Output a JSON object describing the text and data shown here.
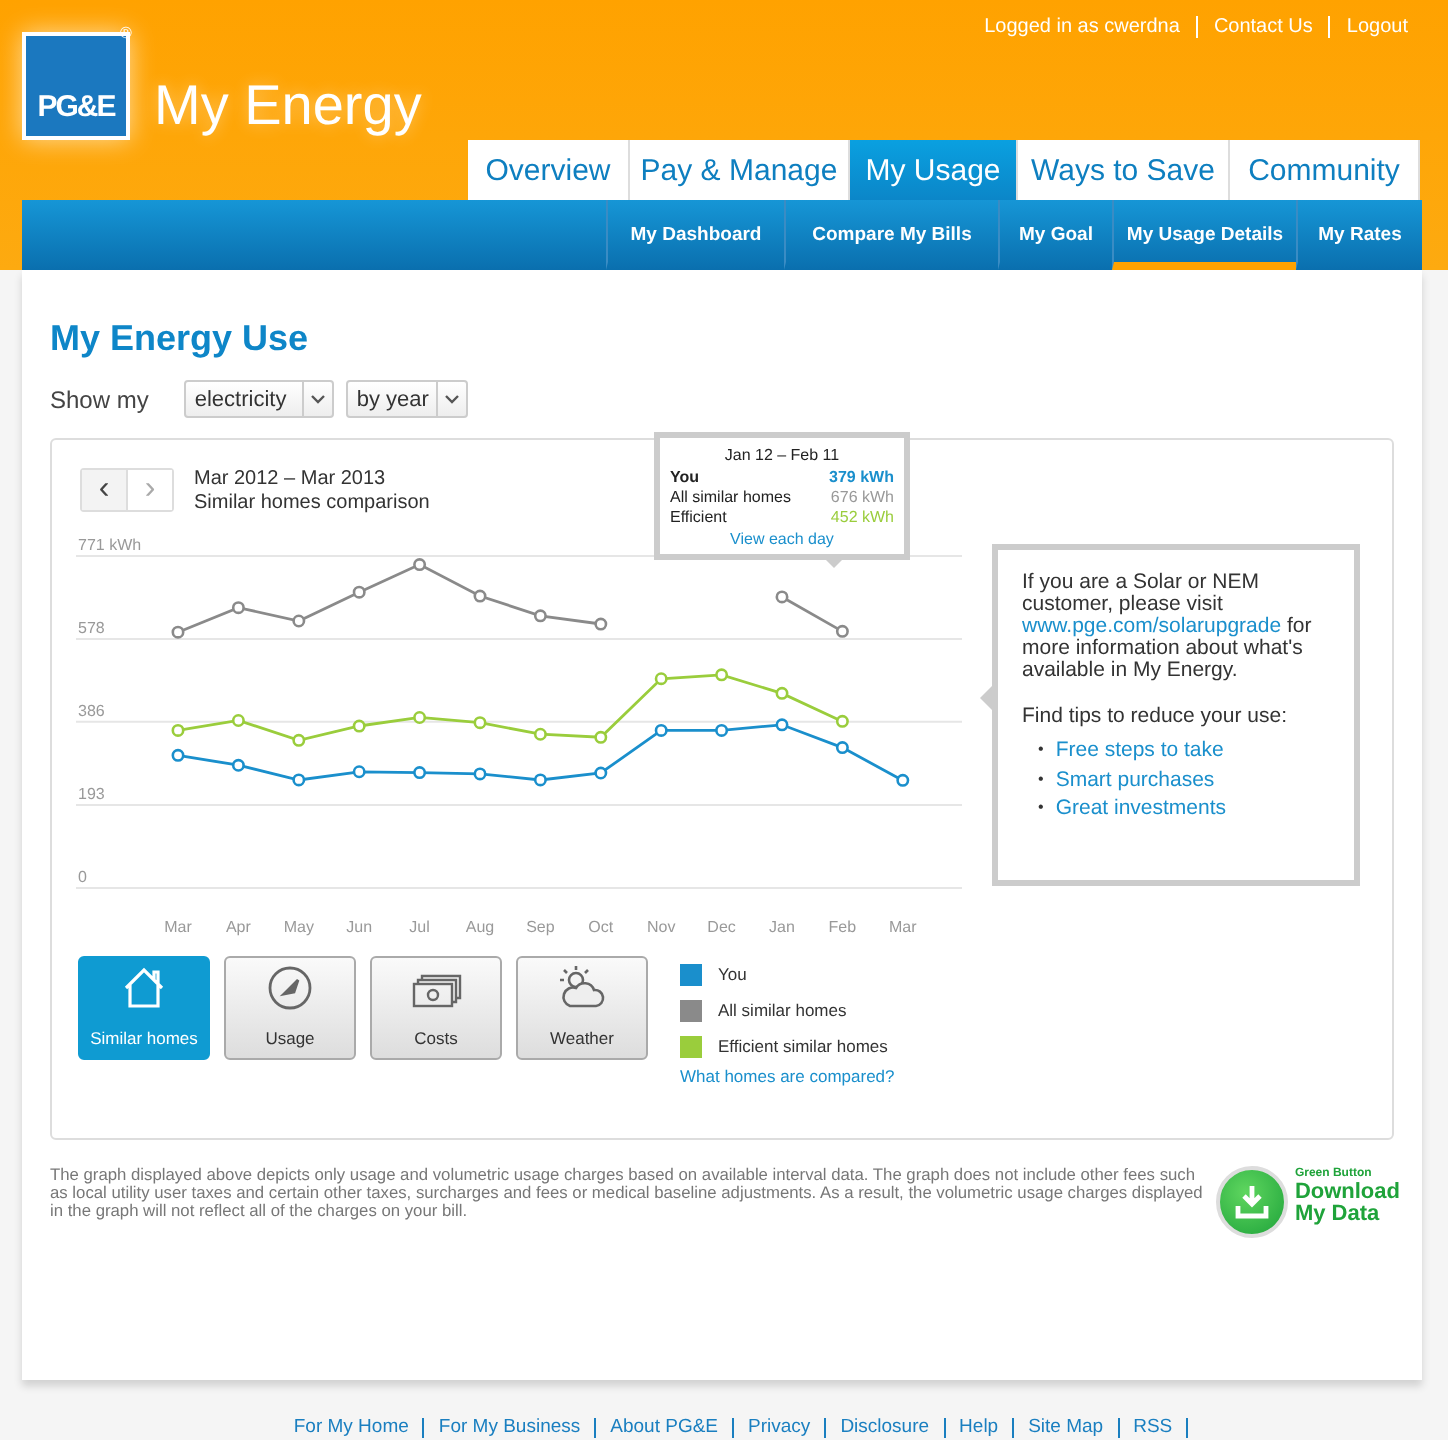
{
  "header": {
    "logo": "PG&E",
    "registered": "®",
    "site_title": "My Energy",
    "user_links": [
      "Logged in as cwerdna",
      "Contact Us",
      "Logout"
    ]
  },
  "tabs": [
    {
      "label": "Overview",
      "selected": false
    },
    {
      "label": "Pay & Manage",
      "selected": false
    },
    {
      "label": "My Usage",
      "selected": true
    },
    {
      "label": "Ways to Save",
      "selected": false
    },
    {
      "label": "Community",
      "selected": false
    }
  ],
  "subtabs": [
    {
      "label": "My Dashboard",
      "selected": false
    },
    {
      "label": "Compare My Bills",
      "selected": false
    },
    {
      "label": "My Goal",
      "selected": false
    },
    {
      "label": "My Usage Details",
      "selected": true
    },
    {
      "label": "My Rates",
      "selected": false
    }
  ],
  "page_title": "My Energy Use",
  "filters": {
    "label": "Show my",
    "fuel": "electricity",
    "period": "by year"
  },
  "chart_header": {
    "prev": "‹",
    "next": "›",
    "range": "Mar 2012 – Mar 2013",
    "subtitle": "Similar homes comparison"
  },
  "chart_data": {
    "type": "line",
    "categories": [
      "Mar",
      "Apr",
      "May",
      "Jun",
      "Jul",
      "Aug",
      "Sep",
      "Oct",
      "Nov",
      "Dec",
      "Jan",
      "Feb",
      "Mar"
    ],
    "ylim": [
      0,
      771
    ],
    "grid": true,
    "yticks": [
      0,
      193,
      386,
      578,
      {
        "value": 771,
        "label": "771 kWh"
      }
    ],
    "series": [
      {
        "name": "You",
        "color": "#1a8fcc",
        "marker": "circle",
        "values": [
          308,
          285,
          251,
          270,
          268,
          265,
          251,
          267,
          366,
          366,
          379,
          326,
          250
        ]
      },
      {
        "name": "All similar homes",
        "color": "#8a8a8a",
        "marker": "circle",
        "values": [
          594,
          651,
          620,
          687,
          751,
          678,
          632,
          613,
          null,
          null,
          676,
          596,
          null
        ]
      },
      {
        "name": "Efficient similar homes",
        "color": "#9acd3c",
        "marker": "circle",
        "values": [
          366,
          389,
          343,
          376,
          396,
          384,
          357,
          350,
          486,
          495,
          452,
          387,
          null
        ]
      }
    ]
  },
  "tooltip": {
    "period": "Jan 12 – Feb 11",
    "rows": [
      {
        "label": "You",
        "value": "379 kWh",
        "color": "#1a8fcc",
        "bold": true
      },
      {
        "label": "All similar homes",
        "value": "676 kWh",
        "color": "#999999",
        "bold": false
      },
      {
        "label": "Efficient",
        "value": "452 kWh",
        "color": "#9acd3c",
        "bold": false
      }
    ],
    "link": "View each day"
  },
  "info_box": {
    "message_before": "If you are a Solar or NEM customer, please visit",
    "link": "www.pge.com/solarupgrade",
    "message_after": "for more information about what's available in My Energy.",
    "tips_heading": "Find tips to reduce your use:",
    "bullet": "•",
    "tips": [
      "Free steps to take",
      "Smart purchases",
      "Great investments"
    ]
  },
  "view_buttons": [
    {
      "label": "Similar homes",
      "kind": "house",
      "selected": true
    },
    {
      "label": "Usage",
      "kind": "gauge",
      "selected": false
    },
    {
      "label": "Costs",
      "kind": "money",
      "selected": false
    },
    {
      "label": "Weather",
      "kind": "weather",
      "selected": false
    }
  ],
  "legend_link": "What homes are compared?",
  "footnote": "The graph displayed above depicts only usage and volumetric usage charges based on available interval data. The graph does not include other fees such as local utility user taxes and certain other taxes, surcharges and fees or medical baseline adjustments. As a result, the volumetric usage charges displayed in the graph will not reflect all of the charges on your bill.",
  "green_button": {
    "small": "Green Button",
    "line1": "Download",
    "line2": "My Data"
  },
  "footer_links": [
    "For My Home",
    "For My Business",
    "About PG&E",
    "Privacy",
    "Disclosure",
    "Help",
    "Site Map",
    "RSS"
  ]
}
